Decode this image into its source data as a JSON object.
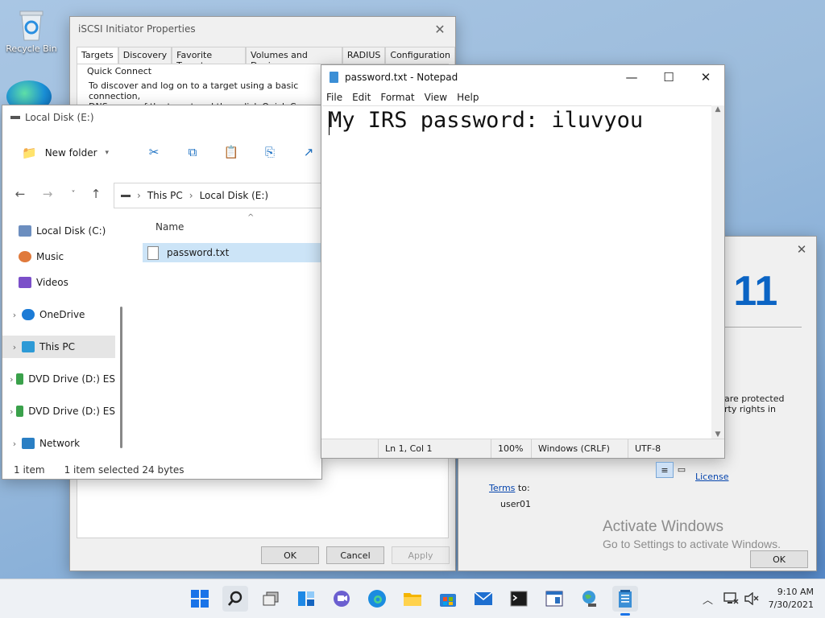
{
  "desktop": {
    "recycle_bin_label": "Recycle Bin"
  },
  "iscsi": {
    "title": "iSCSI Initiator Properties",
    "tabs": [
      "Targets",
      "Discovery",
      "Favorite Targets",
      "Volumes and Devices",
      "RADIUS",
      "Configuration"
    ],
    "quick_connect_label": "Quick Connect",
    "quick_connect_text_1": "To discover and log on to a target using a basic connection,",
    "quick_connect_text_2": "DNS name of the target and then click Quick Connect.",
    "ok_label": "OK",
    "cancel_label": "Cancel",
    "apply_label": "Apply"
  },
  "about": {
    "brand_fragment": "s 11",
    "protected_1": "are protected",
    "protected_2": "rty rights in",
    "license_fragment": "License",
    "terms_label": "Terms",
    "to_label": "to:",
    "user": "user01",
    "ok_label": "OK"
  },
  "watermark": {
    "line1": "Activate Windows",
    "line2": "Go to Settings to activate Windows."
  },
  "explorer": {
    "title": "Local Disk (E:)",
    "new_folder_label": "New folder",
    "breadcrumb": [
      "This PC",
      "Local Disk (E:)"
    ],
    "nav_items": [
      {
        "label": "Local Disk (C:)",
        "chev": "",
        "color": "#6c8ebf"
      },
      {
        "label": "Music",
        "chev": "",
        "color": "#e07a3c"
      },
      {
        "label": "Videos",
        "chev": "",
        "color": "#7b4fc9"
      },
      {
        "label": "OneDrive",
        "chev": "›",
        "color": "#1c7bd6"
      },
      {
        "label": "This PC",
        "chev": "›",
        "color": "#2d9ad6"
      },
      {
        "label": "DVD Drive (D:) ES",
        "chev": "›",
        "color": "#3aa14b"
      },
      {
        "label": "DVD Drive (D:) ES",
        "chev": "›",
        "color": "#3aa14b"
      },
      {
        "label": "Network",
        "chev": "›",
        "color": "#2a7fc4"
      }
    ],
    "column_name": "Name",
    "file_name": "password.txt",
    "status_items": "1 item",
    "status_selected": "1 item selected  24 bytes"
  },
  "notepad": {
    "title": "password.txt - Notepad",
    "menu": [
      "File",
      "Edit",
      "Format",
      "View",
      "Help"
    ],
    "content": "My IRS password: iluvyou",
    "status_pos": "Ln 1, Col 1",
    "status_zoom": "100%",
    "status_eol": "Windows (CRLF)",
    "status_enc": "UTF-8"
  },
  "taskbar": {
    "apps": [
      "start",
      "search",
      "task-view",
      "widgets",
      "chat",
      "edge",
      "file-explorer",
      "store",
      "mail",
      "terminal",
      "app",
      "network-app",
      "notepad"
    ],
    "time": "9:10 AM",
    "date": "7/30/2021"
  }
}
